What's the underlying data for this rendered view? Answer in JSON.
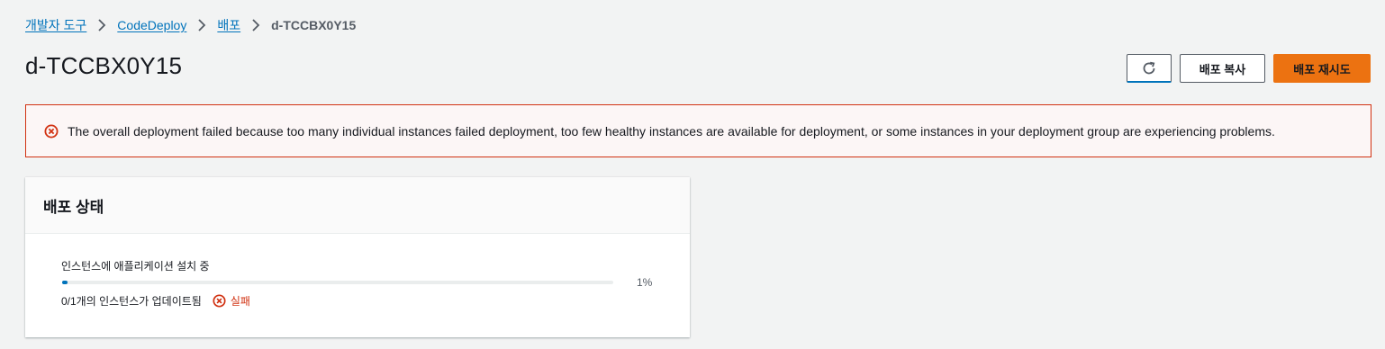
{
  "breadcrumb": {
    "items": [
      "개발자 도구",
      "CodeDeploy",
      "배포"
    ],
    "current": "d-TCCBX0Y15"
  },
  "page": {
    "title": "d-TCCBX0Y15"
  },
  "actions": {
    "refresh_icon": "refresh-icon",
    "copy_label": "배포 복사",
    "retry_label": "배포 재시도"
  },
  "alert": {
    "icon": "error-circle-icon",
    "message": "The overall deployment failed because too many individual instances failed deployment, too few healthy instances are available for deployment, or some instances in your deployment group are experiencing problems."
  },
  "status_panel": {
    "title": "배포 상태",
    "progress_label": "인스턴스에 애플리케이션 설치 중",
    "progress_percent": 1,
    "progress_text": "1%",
    "instances_text": "0/1개의 인스턴스가 업데이트됨",
    "result_label": "실패"
  },
  "colors": {
    "link": "#0073bb",
    "primary": "#ec7211",
    "error": "#d13212",
    "progress": "#0073bb"
  }
}
